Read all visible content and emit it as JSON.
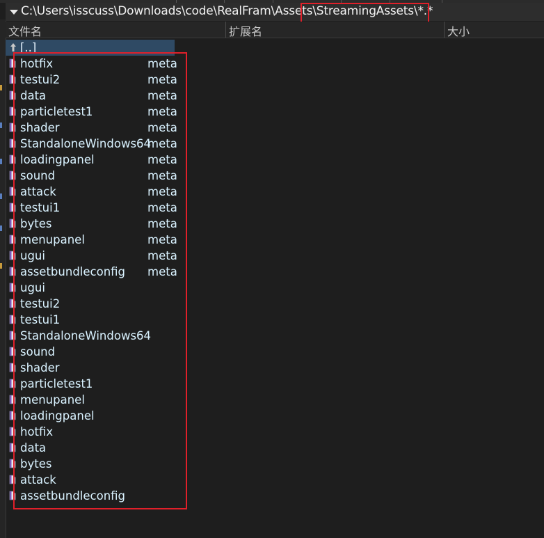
{
  "path": {
    "text": "C:\\Users\\isscuss\\Downloads\\code\\RealFram\\Assets\\StreamingAssets\\*.*"
  },
  "columns": {
    "name": "文件名",
    "ext": "扩展名",
    "size": "大小"
  },
  "up_dir": "[..]",
  "files": [
    {
      "name": "hotfix",
      "ext": "meta"
    },
    {
      "name": "testui2",
      "ext": "meta"
    },
    {
      "name": "data",
      "ext": "meta"
    },
    {
      "name": "particletest1",
      "ext": "meta"
    },
    {
      "name": "shader",
      "ext": "meta"
    },
    {
      "name": "StandaloneWindows64",
      "ext": "meta"
    },
    {
      "name": "loadingpanel",
      "ext": "meta"
    },
    {
      "name": "sound",
      "ext": "meta"
    },
    {
      "name": "attack",
      "ext": "meta"
    },
    {
      "name": "testui1",
      "ext": "meta"
    },
    {
      "name": "bytes",
      "ext": "meta"
    },
    {
      "name": "menupanel",
      "ext": "meta"
    },
    {
      "name": "ugui",
      "ext": "meta"
    },
    {
      "name": "assetbundleconfig",
      "ext": "meta"
    },
    {
      "name": "ugui",
      "ext": ""
    },
    {
      "name": "testui2",
      "ext": ""
    },
    {
      "name": "testui1",
      "ext": ""
    },
    {
      "name": "StandaloneWindows64",
      "ext": ""
    },
    {
      "name": "sound",
      "ext": ""
    },
    {
      "name": "shader",
      "ext": ""
    },
    {
      "name": "particletest1",
      "ext": ""
    },
    {
      "name": "menupanel",
      "ext": ""
    },
    {
      "name": "loadingpanel",
      "ext": ""
    },
    {
      "name": "hotfix",
      "ext": ""
    },
    {
      "name": "data",
      "ext": ""
    },
    {
      "name": "bytes",
      "ext": ""
    },
    {
      "name": "attack",
      "ext": ""
    },
    {
      "name": "assetbundleconfig",
      "ext": ""
    }
  ],
  "colors": {
    "highlight_box": "#e0202a",
    "selected_row": "#2f4a64",
    "file_text": "#d9f2ff",
    "background": "#1e1e1e"
  },
  "icons": {
    "path": "chevron-down-icon",
    "up": "up-arrow-icon",
    "file": "file-icon"
  }
}
